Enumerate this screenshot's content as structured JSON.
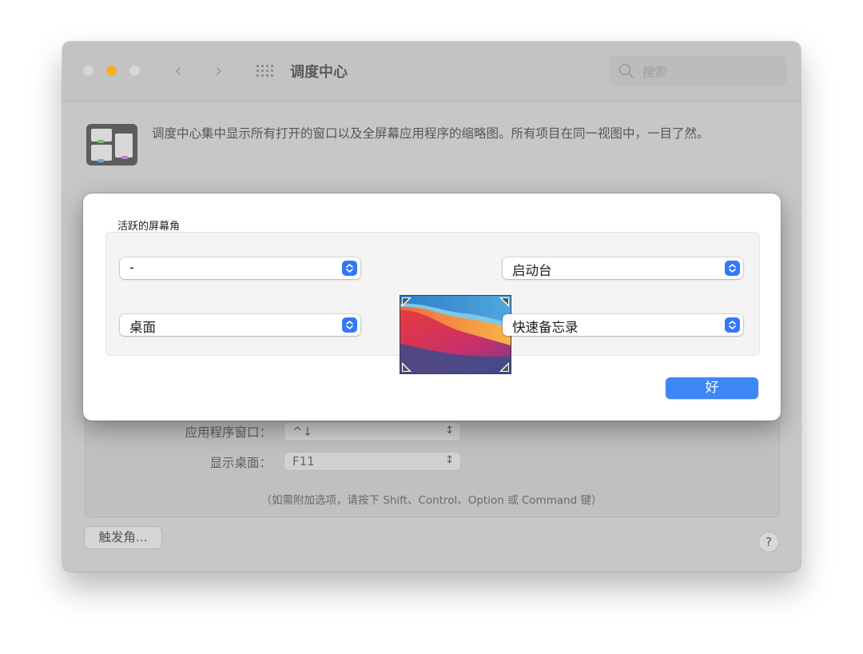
{
  "window": {
    "title": "调度中心",
    "search_placeholder": "搜索",
    "description": "调度中心集中显示所有打开的窗口以及全屏幕应用程序的缩略图。所有项目在同一视图中，一目了然。"
  },
  "shortcuts": {
    "app_windows_label": "应用程序窗口：",
    "app_windows_value": "^↓",
    "show_desktop_label": "显示桌面：",
    "show_desktop_value": "F11",
    "hint": "（如需附加选项，请按下 Shift、Control、Option 或 Command 键）",
    "hot_corners_button": "触发角...",
    "help_button": "?"
  },
  "sheet": {
    "group_label": "活跃的屏幕角",
    "top_left": "-",
    "bottom_left": "桌面",
    "top_right": "启动台",
    "bottom_right": "快速备忘录",
    "ok_button": "好"
  },
  "colors": {
    "accent": "#3478f6",
    "traffic_minimize": "#f2b21c"
  }
}
